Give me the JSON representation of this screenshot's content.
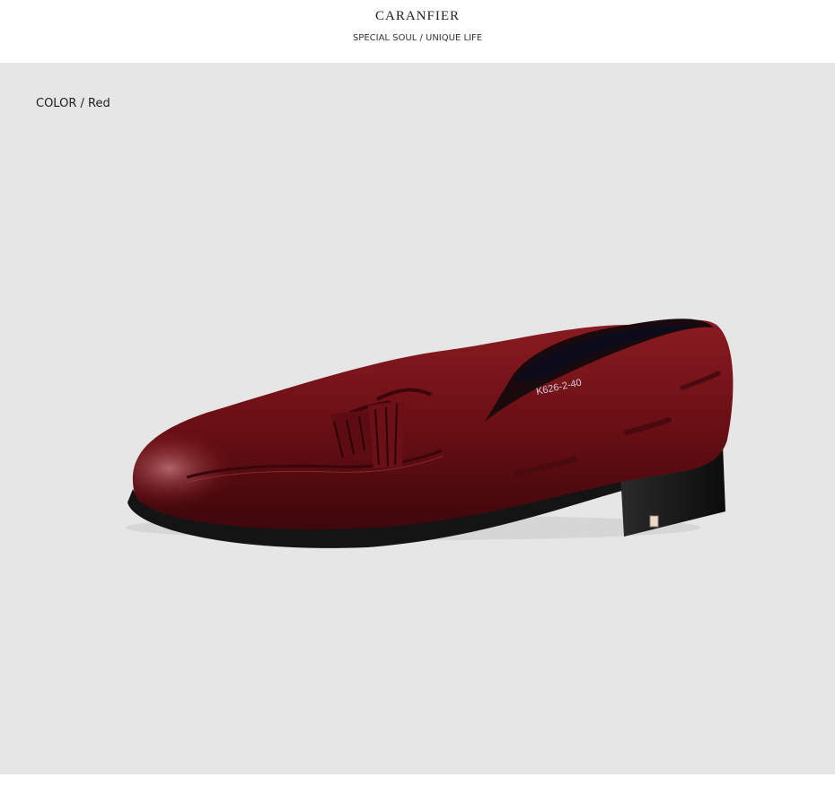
{
  "header": {
    "brand": "CARANFIER",
    "tagline": "SPECIAL SOUL / UNIQUE LIFE"
  },
  "product": {
    "color_label": "COLOR",
    "color_separator": "/",
    "color_value": "Red",
    "size_stamp": "K626-2-40",
    "image_icon": "tassel-loafer-shoe"
  },
  "colors": {
    "stage_background": "#e6e6e6",
    "leather": "#6e1016",
    "sole": "#141414"
  }
}
